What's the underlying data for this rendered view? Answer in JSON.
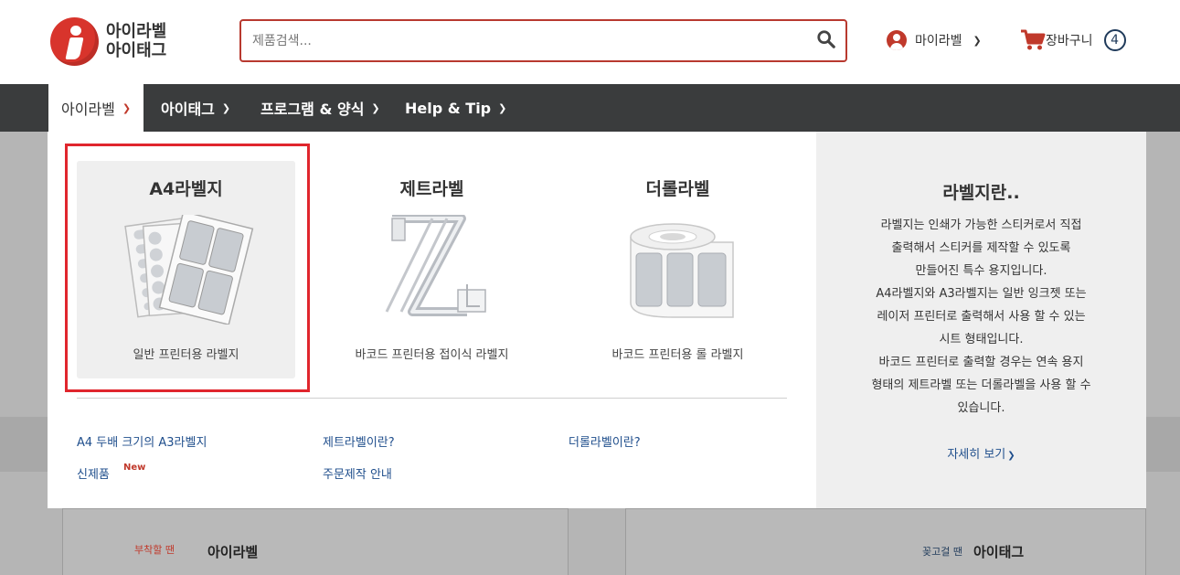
{
  "brand": {
    "line1": "아이라벨",
    "line2": "아이태그"
  },
  "search": {
    "placeholder": "제품검색...",
    "value": ""
  },
  "account": {
    "label": "마이라벨"
  },
  "cart": {
    "label": "장바구니",
    "count": "4"
  },
  "nav": {
    "items": [
      {
        "label": "아이라벨"
      },
      {
        "label": "아이태그"
      },
      {
        "label": "프로그램 & 양식"
      },
      {
        "label": "Help & Tip"
      }
    ]
  },
  "menu": {
    "categories": [
      {
        "title": "A4라벨지",
        "subtitle": "일반 프린터용 라벨지",
        "icon": "a4-label-sheet-icon"
      },
      {
        "title": "제트라벨",
        "subtitle": "바코드 프린터용 접이식 라벨지",
        "icon": "zet-label-icon"
      },
      {
        "title": "더롤라벨",
        "subtitle": "바코드 프린터용 롤 라벨지",
        "icon": "roll-label-icon"
      }
    ],
    "links": [
      {
        "label": "A4 두배 크기의 A3라벨지"
      },
      {
        "label": "신제품"
      },
      {
        "label": "제트라벨이란?"
      },
      {
        "label": "주문제작 안내"
      },
      {
        "label": "더롤라벨이란?"
      }
    ],
    "new_badge": "New",
    "info": {
      "title": "라벨지란..",
      "lines": [
        "라벨지는 인쇄가 가능한 스티커로서 직접",
        "출력해서 스티커를 제작할 수 있도록",
        "만들어진 특수 용지입니다.",
        "A4라벨지와 A3라벨지는 일반 잉크젯 또는",
        "레이저 프린터로 출력해서 사용 할 수 있는",
        "시트 형태입니다.",
        "바코드 프린터로 출력할 경우는 연속 용지",
        "형태의 제트라벨 또는 더롤라벨을 사용 할 수",
        "있습니다."
      ],
      "more_link": "자세히 보기"
    }
  },
  "background": {
    "card1_pre": "부착할 땐",
    "card1_brand": "아이라벨",
    "card2_pre": "꽂고걸 땐",
    "card2_brand": "아이태그"
  },
  "colors": {
    "accent": "#c0392b",
    "nav_bg": "#3a3c3d",
    "highlight": "#e0262d",
    "link": "#1f4e8c"
  }
}
